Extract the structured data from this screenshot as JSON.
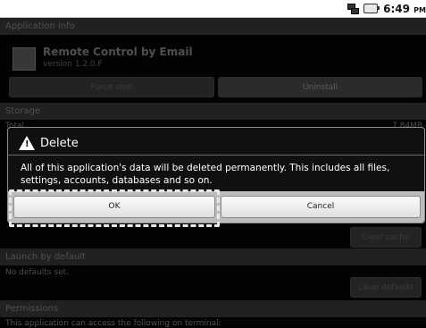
{
  "status_bar": {
    "time": "6:49",
    "ampm": "PM",
    "icons": [
      "network-icon",
      "battery-icon"
    ]
  },
  "app_info": {
    "header": "Application info",
    "app_name": "Remote Control by Email",
    "version": "version 1.2.0.F",
    "force_stop_label": "Force stop",
    "uninstall_label": "Uninstall"
  },
  "storage": {
    "header": "Storage",
    "total_label": "Total",
    "total_value": "7.84MB"
  },
  "cache": {
    "clear_cache_label": "Clear cache"
  },
  "launch_default": {
    "header": "Launch by default",
    "text": "No defaults set.",
    "clear_defaults_label": "Clear defaults"
  },
  "permissions": {
    "header": "Permissions",
    "text": "This application can access the following on terminal:"
  },
  "dialog": {
    "title": "Delete",
    "message": "All of this application's data will be deleted permanently. This includes all files, settings, accounts, databases and so on.",
    "ok_label": "OK",
    "cancel_label": "Cancel"
  }
}
